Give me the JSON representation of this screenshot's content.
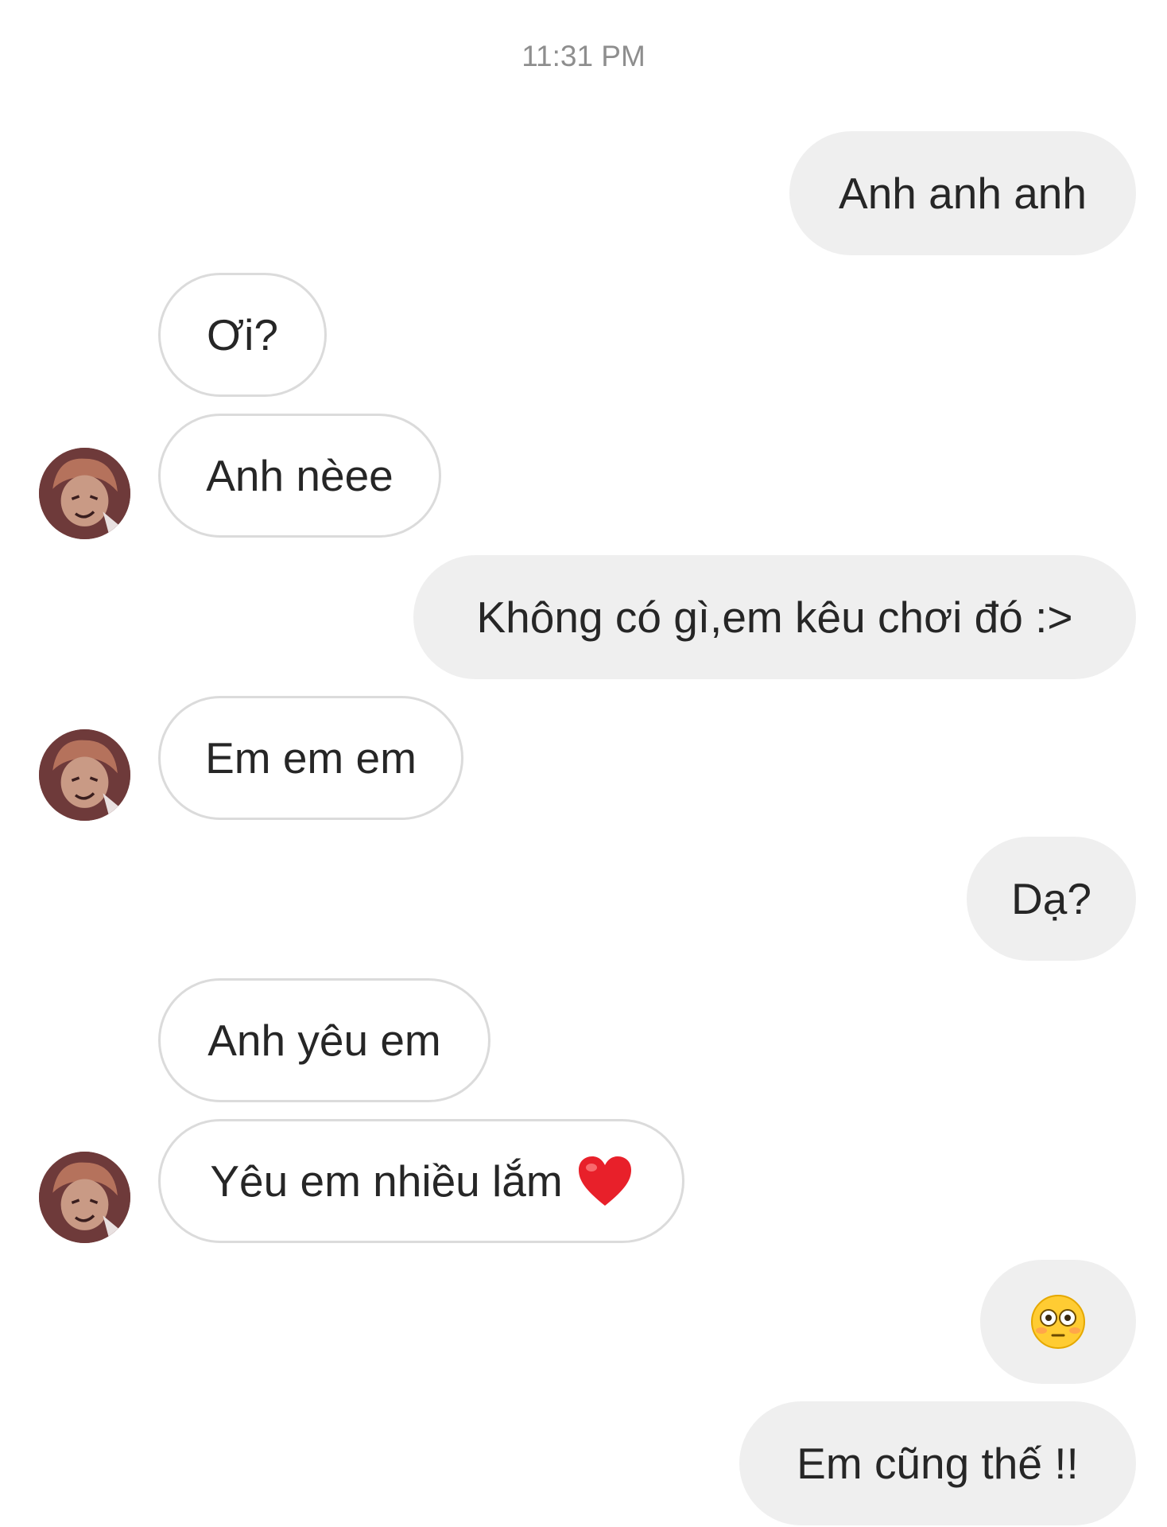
{
  "conversation": {
    "timestamp": "11:31 PM",
    "messages": [
      {
        "side": "sent",
        "text": "Anh anh anh"
      },
      {
        "side": "received",
        "text": "Ơi?"
      },
      {
        "side": "received",
        "text": "Anh nèee"
      },
      {
        "side": "sent",
        "text": "Không có gì,em kêu chơi đó :>"
      },
      {
        "side": "received",
        "text": "Em em em"
      },
      {
        "side": "sent",
        "text": "Dạ?"
      },
      {
        "side": "received",
        "text": "Anh yêu em"
      },
      {
        "side": "received",
        "text": "Yêu em nhiều lắm",
        "emoji": "red-heart"
      },
      {
        "side": "sent",
        "emoji": "flushed-face"
      },
      {
        "side": "sent",
        "text": "Em cũng thế !!"
      }
    ]
  },
  "colors": {
    "sent_bubble": "#efefef",
    "received_border": "#dbdbdb",
    "timestamp": "#8e8e8e",
    "text": "#262626"
  }
}
